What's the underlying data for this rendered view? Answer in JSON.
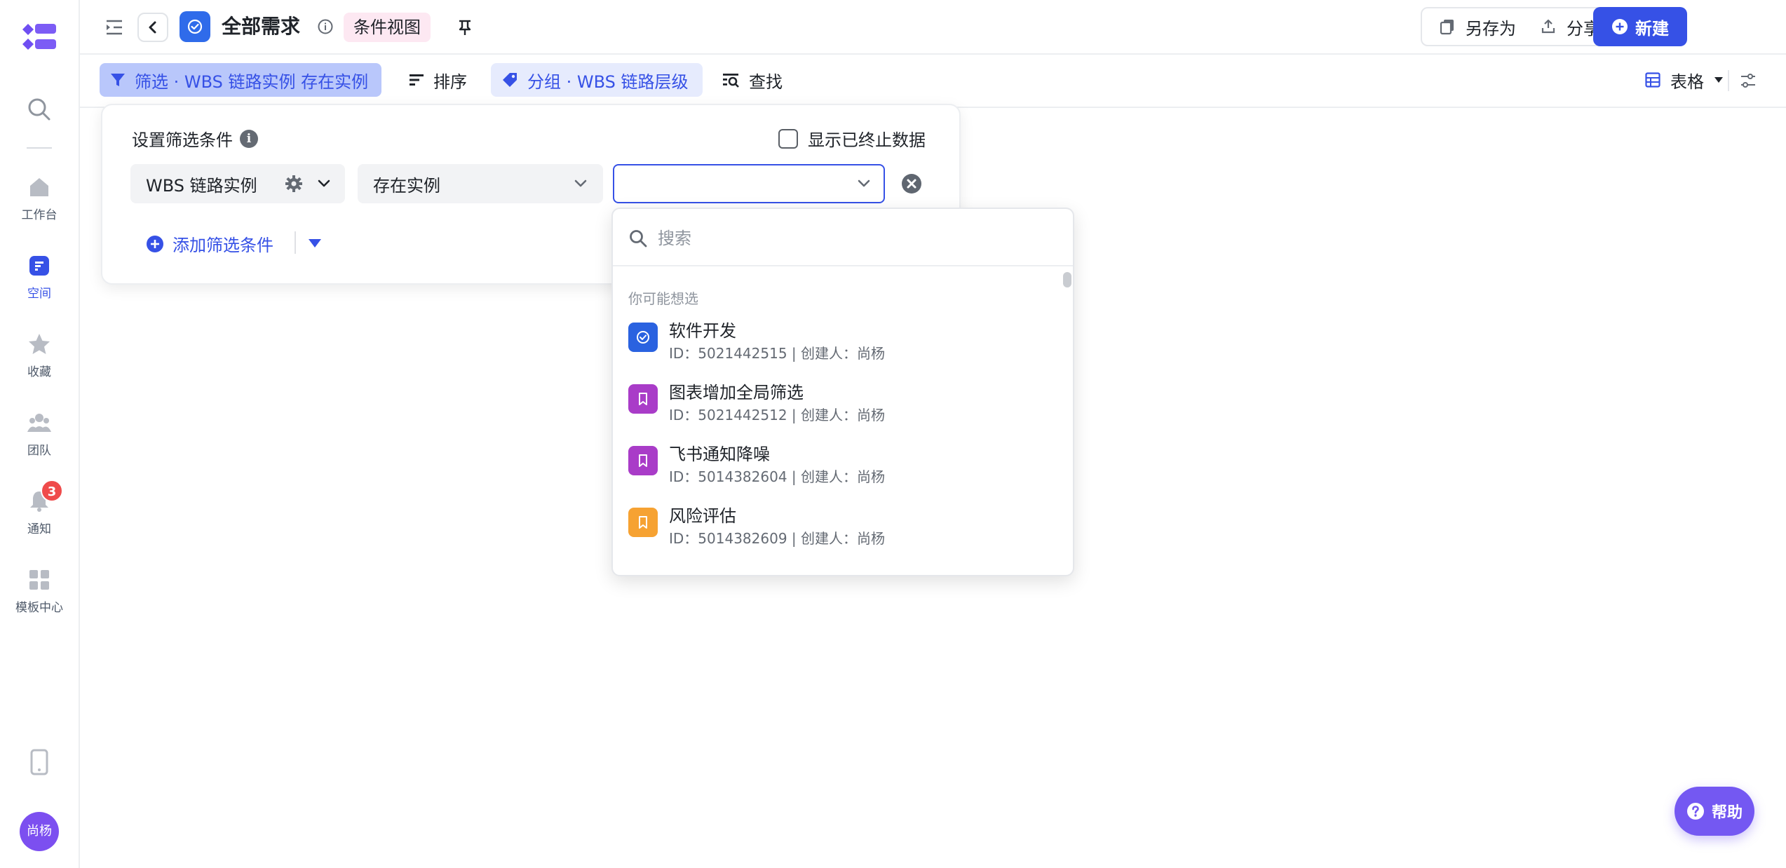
{
  "rail": {
    "items": [
      {
        "label": "工作台"
      },
      {
        "label": "空间"
      },
      {
        "label": "收藏"
      },
      {
        "label": "团队"
      },
      {
        "label": "通知"
      },
      {
        "label": "模板中心"
      }
    ],
    "notification_count": "3",
    "avatar_text": "尚杨",
    "active_color": "#3651e6"
  },
  "header": {
    "title": "全部需求",
    "view_tag": "条件视图",
    "save_as": "另存为",
    "share": "分享",
    "new": "新建"
  },
  "toolbar": {
    "filter": "筛选 · WBS 链路实例 存在实例",
    "sort": "排序",
    "group": "分组 · WBS 链路层级",
    "find": "查找",
    "view_mode": "表格"
  },
  "filter_panel": {
    "title": "设置筛选条件",
    "show_terminated": "显示已终止数据",
    "field": "WBS 链路实例",
    "operator": "存在实例",
    "value": "",
    "add_condition": "添加筛选条件"
  },
  "dropdown": {
    "search_placeholder": "搜索",
    "section": "你可能想选",
    "items": [
      {
        "name": "软件开发",
        "meta": "ID：5021442515 | 创建人：尚杨",
        "icon": "check-circle-icon",
        "color": "#2a62e0"
      },
      {
        "name": "图表增加全局筛选",
        "meta": "ID：5021442512 | 创建人：尚杨",
        "icon": "bookmark-icon",
        "color": "#a93cc8"
      },
      {
        "name": "飞书通知降噪",
        "meta": "ID：5014382604 | 创建人：尚杨",
        "icon": "bookmark-icon",
        "color": "#a93cc8"
      },
      {
        "name": "风险评估",
        "meta": "ID：5014382609 | 创建人：尚杨",
        "icon": "bookmark-icon",
        "color": "#f6a232"
      }
    ]
  },
  "help": {
    "label": "帮助"
  }
}
